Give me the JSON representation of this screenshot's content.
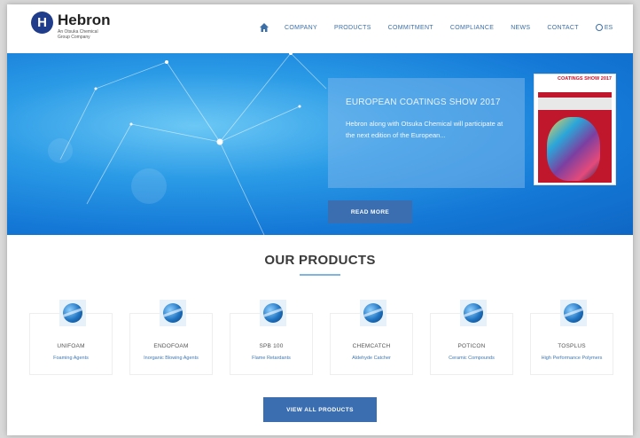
{
  "header": {
    "logo_letter": "H",
    "logo_name": "Hebron",
    "logo_subtitle": "An Otsuka Chemical Group Company",
    "nav": [
      "COMPANY",
      "PRODUCTS",
      "COMMITMENT",
      "COMPLIANCE",
      "NEWS",
      "CONTACT"
    ],
    "lang": "ES",
    "icons": {
      "home": "home-icon",
      "language": "globe-icon"
    }
  },
  "hero": {
    "title": "EUROPEAN COATINGS SHOW 2017",
    "text": "Hebron along with Otsuka Chemical will participate at the next edition of the European...",
    "read_more": "READ MORE",
    "magazine_title": "COATINGS SHOW 2017"
  },
  "products": {
    "title": "OUR PRODUCTS",
    "items": [
      {
        "name": "UNIFOAM",
        "category": "Foaming Agents"
      },
      {
        "name": "ENDOFOAM",
        "category": "Inorganic Blowing Agents"
      },
      {
        "name": "SPB 100",
        "category": "Flame Retardants"
      },
      {
        "name": "CHEMCATCH",
        "category": "Aldehyde Catcher"
      },
      {
        "name": "POTICON",
        "category": "Ceramic Compounds"
      },
      {
        "name": "TOSPLUS",
        "category": "High Performance Polymers"
      }
    ],
    "view_all": "VIEW ALL PRODUCTS"
  },
  "colors": {
    "brand_blue": "#1f3d8a",
    "button_blue": "#3a6eb0",
    "link_blue": "#3c6fa8",
    "hero_blue": "#1478d6"
  }
}
